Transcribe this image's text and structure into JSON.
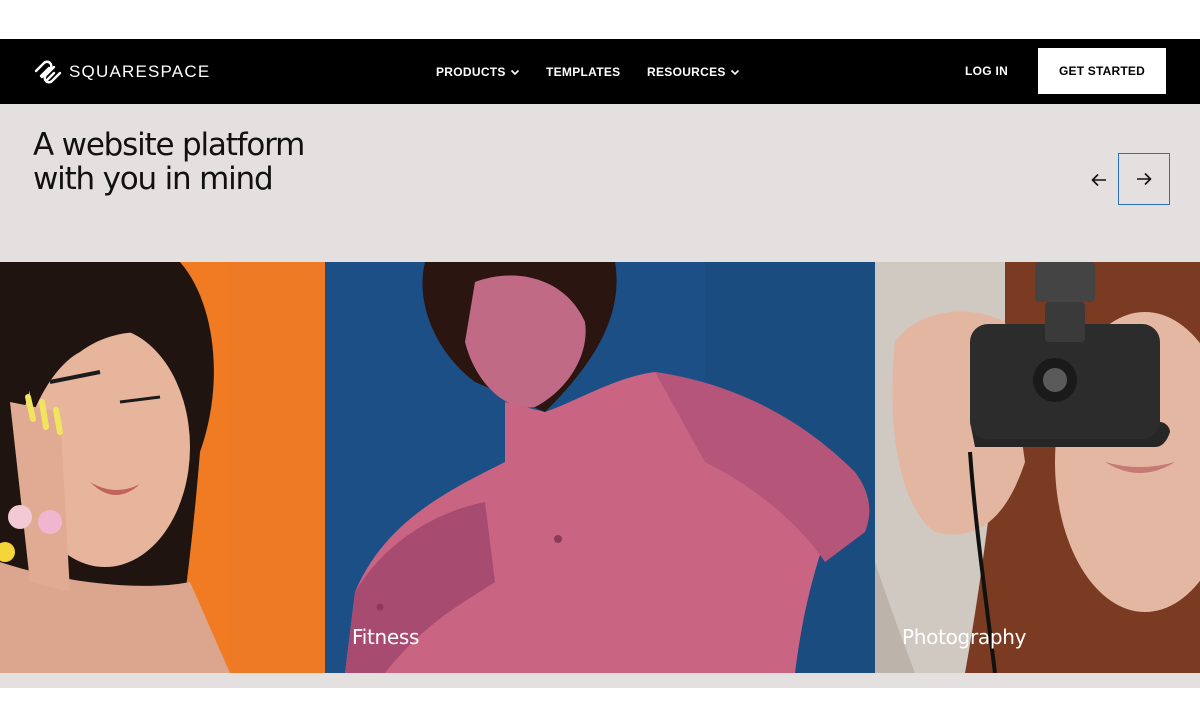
{
  "brand": {
    "name": "SQUARESPACE",
    "logo_icon": "squarespace-logo-icon"
  },
  "nav": {
    "items": [
      {
        "label": "PRODUCTS",
        "has_dropdown": true
      },
      {
        "label": "TEMPLATES",
        "has_dropdown": false
      },
      {
        "label": "RESOURCES",
        "has_dropdown": true
      }
    ],
    "login_label": "LOG IN",
    "cta_label": "GET STARTED"
  },
  "hero": {
    "headline_line1": "A website platform",
    "headline_line2": "with you in mind",
    "prev_icon": "arrow-left-icon",
    "next_icon": "arrow-right-icon"
  },
  "cards": [
    {
      "label": "",
      "background": "#f07b22"
    },
    {
      "label": "Fitness",
      "background": "#1c4f86"
    },
    {
      "label": "Photography",
      "background": "#cfc9c2"
    }
  ],
  "colors": {
    "navbar": "#000000",
    "hero_bg": "#e4e0df",
    "accent_focus": "#2c6fbd"
  }
}
